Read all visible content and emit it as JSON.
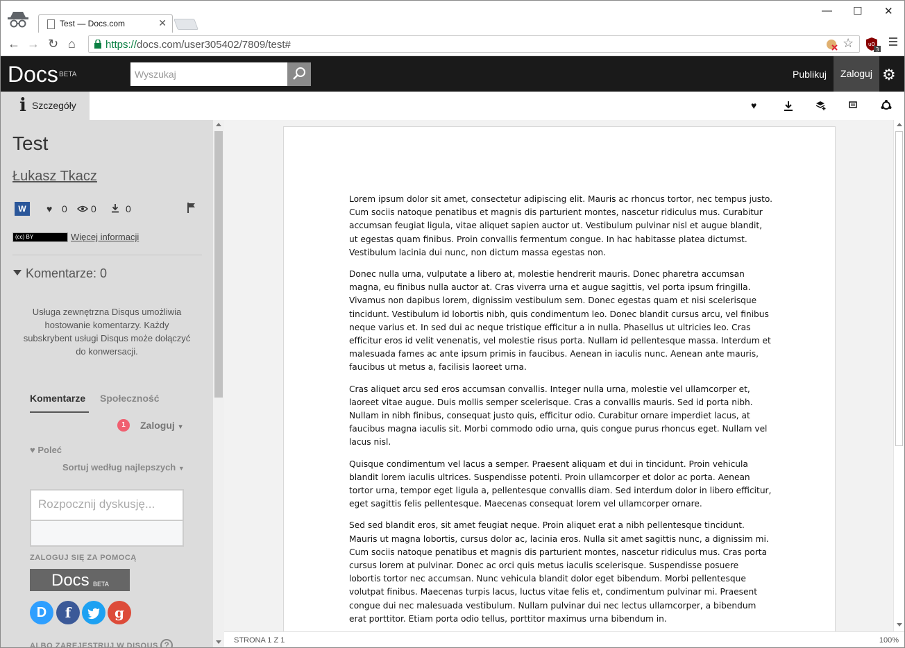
{
  "browser": {
    "tab_title": "Test — Docs.com",
    "url_protocol": "https://",
    "url_rest": "docs.com/user305402/7809/test#",
    "ublock_count": "3"
  },
  "header": {
    "logo": "Docs",
    "beta": "BETA",
    "search_placeholder": "Wyszukaj",
    "publish": "Publikuj",
    "login": "Zaloguj"
  },
  "tabs": {
    "details": "Szczegóły"
  },
  "sidebar": {
    "title": "Test",
    "author": "Łukasz Tkacz",
    "likes": "0",
    "views": "0",
    "downloads": "0",
    "license_badge": "(cc) BY",
    "more_info": "Więcej informacji",
    "comments_heading": "Komentarze: 0",
    "disqus_info": "Usługa zewnętrzna Disqus umożliwia hostowanie komentarzy. Każdy subskrybent usługi Disqus może dołączyć do konwersacji.",
    "disqus": {
      "tab_comments": "Komentarze",
      "tab_community": "Społeczność",
      "notif_count": "1",
      "login": "Zaloguj",
      "recommend": "Poleć",
      "sort": "Sortuj według najlepszych",
      "input_placeholder": "Rozpocznij dyskusję...",
      "sign_in_with": "ZALOGUJ SIĘ ZA POMOCĄ",
      "docs_logo": "Docs",
      "docs_beta": "BETA",
      "register": "ALBO ZAREJESTRUJ W DISQUS",
      "help": "?"
    }
  },
  "document": {
    "paragraphs": [
      "Lorem ipsum dolor sit amet, consectetur adipiscing elit. Mauris ac rhoncus tortor, nec tempus justo. Cum sociis natoque penatibus et magnis dis parturient montes, nascetur ridiculus mus. Curabitur accumsan feugiat ligula, vitae aliquet sapien auctor ut. Vestibulum pulvinar nisl et augue blandit, ut egestas quam finibus. Proin convallis fermentum congue. In hac habitasse platea dictumst. Vestibulum lacinia dui nunc, non dictum massa egestas non.",
      "Donec nulla urna, vulputate a libero at, molestie hendrerit mauris. Donec pharetra accumsan magna, eu finibus nulla auctor at. Cras viverra urna et augue sagittis, vel porta ipsum fringilla. Vivamus non dapibus lorem, dignissim vestibulum sem. Donec egestas quam et nisi scelerisque tincidunt. Vestibulum id lobortis nibh, quis condimentum leo. Donec blandit cursus arcu, vel finibus neque varius et. In sed dui ac neque tristique efficitur a in nulla. Phasellus ut ultricies leo. Cras efficitur eros id velit venenatis, vel molestie risus porta. Nullam id pellentesque massa. Interdum et malesuada fames ac ante ipsum primis in faucibus. Aenean in iaculis nunc. Aenean ante mauris, faucibus ut metus a, facilisis laoreet urna.",
      "Cras aliquet arcu sed eros accumsan convallis. Integer nulla urna, molestie vel ullamcorper et, laoreet vitae augue. Duis mollis semper scelerisque. Cras a convallis mauris. Sed id porta nibh. Nullam in nibh finibus, consequat justo quis, efficitur odio. Curabitur ornare imperdiet lacus, at faucibus magna iaculis sit. Morbi commodo odio urna, quis congue purus rhoncus eget. Nullam vel lacus nisl.",
      "Quisque condimentum vel lacus a semper. Praesent aliquam et dui in tincidunt. Proin vehicula blandit lorem iaculis ultrices. Suspendisse potenti. Proin ullamcorper et dolor ac porta. Aenean tortor urna, tempor eget ligula a, pellentesque convallis diam. Sed interdum dolor in libero efficitur, eget sagittis felis pellentesque. Maecenas consequat lorem vel ullamcorper ornare.",
      "Sed sed blandit eros, sit amet feugiat neque. Proin aliquet erat a nibh pellentesque tincidunt. Mauris ut magna lobortis, cursus dolor ac, lacinia eros. Nulla sit amet sagittis nunc, a dignissim mi. Cum sociis natoque penatibus et magnis dis parturient montes, nascetur ridiculus mus. Cras porta cursus lorem at pulvinar. Donec ac orci quis metus iaculis scelerisque. Suspendisse posuere lobortis tortor nec accumsan. Nunc vehicula blandit dolor eget bibendum. Morbi pellentesque volutpat finibus. Maecenas turpis lacus, luctus vitae felis et, condimentum pulvinar mi. Praesent congue dui nec malesuada vestibulum. Nullam pulvinar dui nec lectus ullamcorper, a bibendum erat porttitor. Etiam porta odio tellus, porttitor maximus urna bibendum in."
    ],
    "page_info": "STRONA 1 Z 1",
    "zoom": "100%"
  },
  "colors": {
    "header_bg": "#1a1a1a",
    "sidebar_bg": "#dcdcdc",
    "url_green": "#0b8043",
    "disqus_badge": "#f05f70",
    "disqus_blue": "#2e9fff",
    "facebook": "#3b5998",
    "twitter": "#1da1f2",
    "google": "#dd4b39"
  }
}
